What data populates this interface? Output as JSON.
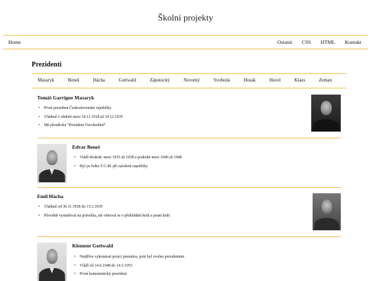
{
  "site": {
    "title": "Školní projekty"
  },
  "topnav": {
    "home": "Home",
    "right": [
      "Ostatní",
      "CSS",
      "HTML",
      "Kontakt"
    ]
  },
  "section": {
    "title": "Prezidenti"
  },
  "subnav": [
    "Masaryk",
    "Beneš",
    "Hácha",
    "Gottwald",
    "Zápotocký",
    "Novotný",
    "Svoboda",
    "Husák",
    "Havel",
    "Klaus",
    "Zeman"
  ],
  "presidents": [
    {
      "name": "Tomáš Garrigue Masaryk",
      "facts": [
        "První prezident Československé republiky",
        "Vládnul v období mezi 14.11.1918 až 14.12.1935",
        "Má přezdívku \"Prezident Osvoboditel\""
      ],
      "photo_icon": "portrait-photo"
    },
    {
      "name": "Edvar Beneš",
      "facts": [
        "Vládl dvakrát: mezi 1935 až 1938 a podruhé mezi 1940 až 1948",
        "Byl po boku T.G.M. při založení republiky"
      ],
      "photo_icon": "portrait-photo"
    },
    {
      "name": "Emil Hácha",
      "facts": [
        "Vládnul od 30.11.1938 do 15.3.1939",
        "Původně vystudoval na právníka, ale věnoval se o překládání knih a psaní knih"
      ],
      "photo_icon": "portrait-photo"
    },
    {
      "name": "Klement Gottwald",
      "facts": [
        "Nejdříve vykonával pozici premiéra, poté byl zvolen prezidentem",
        "Vládl od 14.6.1948 do 14.3.1953",
        "První komunistický prezident"
      ],
      "photo_icon": "portrait-photo"
    }
  ],
  "colors": {
    "accent": "#f0c04a"
  }
}
